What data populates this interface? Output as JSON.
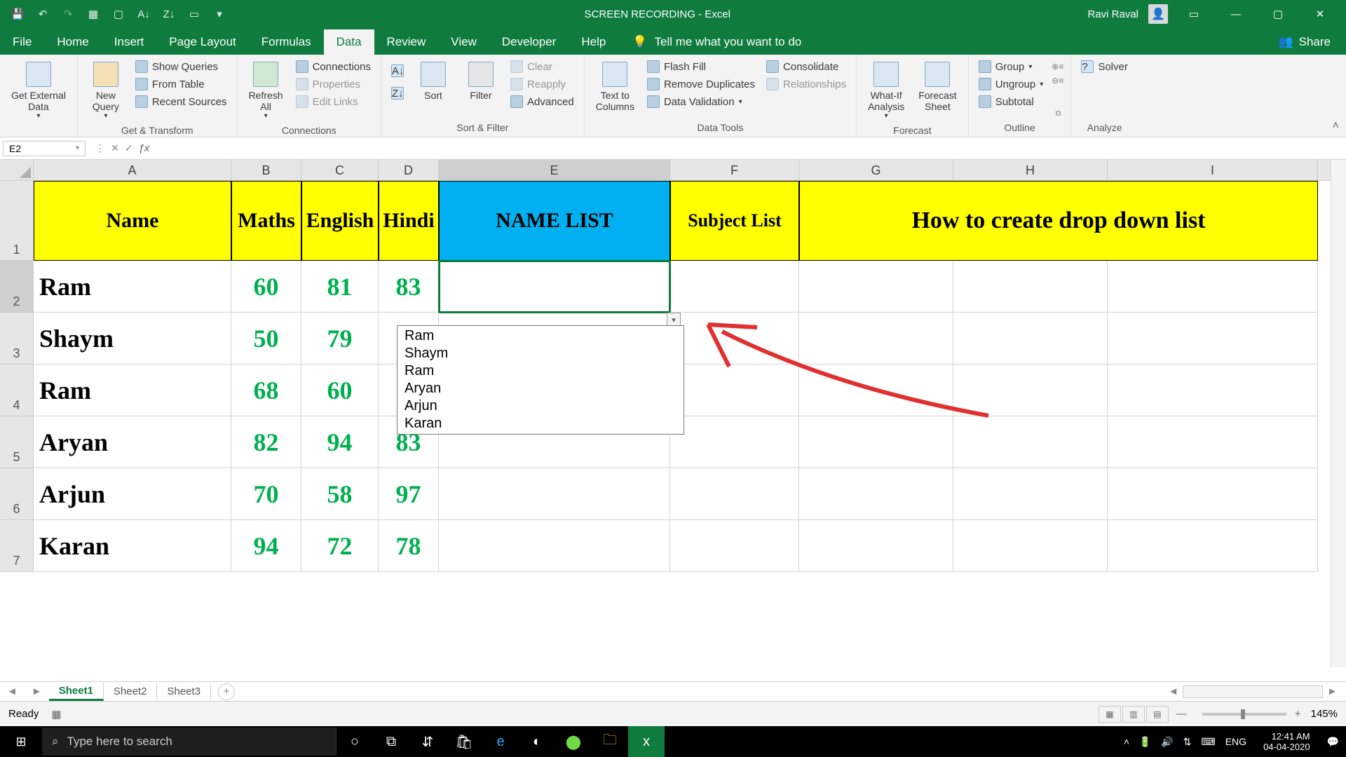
{
  "title": "SCREEN RECORDING  -  Excel",
  "user": "Ravi Raval",
  "tabs": [
    "File",
    "Home",
    "Insert",
    "Page Layout",
    "Formulas",
    "Data",
    "Review",
    "View",
    "Developer",
    "Help"
  ],
  "activeTab": "Data",
  "tellme": "Tell me what you want to do",
  "share": "Share",
  "ribbon": {
    "g1": {
      "label": "",
      "b1": "Get External\nData"
    },
    "g2": {
      "label": "Get & Transform",
      "b1": "New\nQuery",
      "s1": "Show Queries",
      "s2": "From Table",
      "s3": "Recent Sources"
    },
    "g3": {
      "label": "Connections",
      "b1": "Refresh\nAll",
      "s1": "Connections",
      "s2": "Properties",
      "s3": "Edit Links"
    },
    "g4": {
      "label": "Sort & Filter",
      "b1": "Sort",
      "b2": "Filter",
      "s1": "Clear",
      "s2": "Reapply",
      "s3": "Advanced"
    },
    "g5": {
      "label": "Data Tools",
      "b1": "Text to\nColumns",
      "s1": "Flash Fill",
      "s2": "Remove Duplicates",
      "s3": "Data Validation",
      "s4": "Consolidate",
      "s5": "Relationships"
    },
    "g6": {
      "label": "Forecast",
      "b1": "What-If\nAnalysis",
      "b2": "Forecast\nSheet"
    },
    "g7": {
      "label": "Outline",
      "s1": "Group",
      "s2": "Ungroup",
      "s3": "Subtotal"
    },
    "g8": {
      "label": "Analyze",
      "s1": "Solver"
    }
  },
  "namebox": "E2",
  "headers": {
    "A": "Name",
    "B": "Maths",
    "C": "English",
    "D": "Hindi",
    "E": "NAME LIST",
    "F": "Subject List",
    "merged": "How to create drop down list"
  },
  "rows": [
    {
      "n": "Ram",
      "m": "60",
      "e": "81",
      "h": "83"
    },
    {
      "n": "Shaym",
      "m": "50",
      "e": "79",
      "h": ""
    },
    {
      "n": "Ram",
      "m": "68",
      "e": "60",
      "h": ""
    },
    {
      "n": "Aryan",
      "m": "82",
      "e": "94",
      "h": "83"
    },
    {
      "n": "Arjun",
      "m": "70",
      "e": "58",
      "h": "97"
    },
    {
      "n": "Karan",
      "m": "94",
      "e": "72",
      "h": "78"
    }
  ],
  "dropdown": [
    "Ram",
    "Shaym",
    "Ram",
    "Aryan",
    "Arjun",
    "Karan"
  ],
  "sheets": [
    "Sheet1",
    "Sheet2",
    "Sheet3"
  ],
  "status": "Ready",
  "zoom": "145%",
  "taskbar": {
    "search": "Type here to search",
    "lang": "ENG",
    "time": "12:41 AM",
    "date": "04-04-2020"
  }
}
